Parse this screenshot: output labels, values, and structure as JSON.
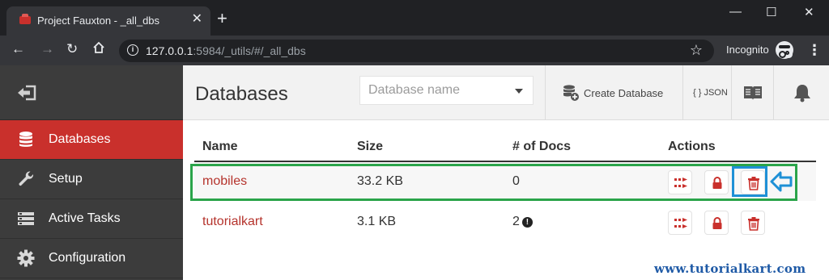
{
  "browser": {
    "tab_title": "Project Fauxton - _all_dbs",
    "tab_close": "✕",
    "new_tab": "+",
    "url_host": "127.0.0.1",
    "url_path": ":5984/_utils/#/_all_dbs",
    "incognito_label": "Incognito",
    "window_controls": {
      "minimize": "—",
      "maximize": "☐",
      "close": "✕"
    }
  },
  "sidebar": {
    "items": [
      {
        "label": "Databases",
        "icon": "database-icon",
        "active": true
      },
      {
        "label": "Setup",
        "icon": "wrench-icon",
        "active": false
      },
      {
        "label": "Active Tasks",
        "icon": "tasks-icon",
        "active": false
      },
      {
        "label": "Configuration",
        "icon": "gear-icon",
        "active": false
      }
    ]
  },
  "header": {
    "title": "Databases",
    "search_placeholder": "Database name",
    "create_label": "Create Database",
    "json_label": "{ } JSON"
  },
  "table": {
    "columns": [
      "Name",
      "Size",
      "# of Docs",
      "Actions"
    ],
    "rows": [
      {
        "name": "mobiles",
        "size": "33.2 KB",
        "docs": "0",
        "warning": false
      },
      {
        "name": "tutorialkart",
        "size": "3.1 KB",
        "docs": "2",
        "warning": true
      }
    ]
  },
  "watermark": "www.tutorialkart.com",
  "colors": {
    "accent_red": "#c9302c",
    "link_red": "#b5332c",
    "highlight_green": "#2aa44a",
    "highlight_blue": "#1e90d6",
    "sidebar_bg": "#3c3c3c"
  }
}
